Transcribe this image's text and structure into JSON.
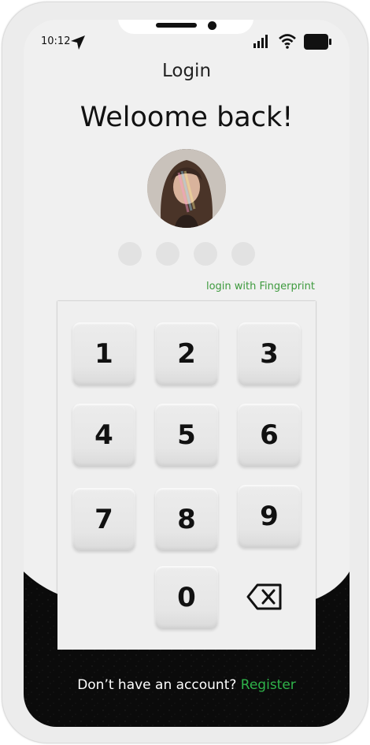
{
  "status_bar": {
    "time": "10:12",
    "icons": [
      "location-arrow-icon",
      "signal-icon",
      "wifi-icon",
      "battery-icon"
    ]
  },
  "header": {
    "title": "Login"
  },
  "welcome": {
    "text": "Weloome back!"
  },
  "pin": {
    "dot_count": 4,
    "entered": 0
  },
  "fingerprint": {
    "label": "login with Fingerprint",
    "color": "#3d9a3d"
  },
  "keypad": {
    "keys": [
      "1",
      "2",
      "3",
      "4",
      "5",
      "6",
      "7",
      "8",
      "9",
      "0"
    ],
    "backspace_icon": "backspace-icon"
  },
  "footer": {
    "prompt": "Don’t have an account?",
    "register_label": "Register",
    "register_color": "#2fb34a"
  },
  "colors": {
    "background": "#f0f0f0",
    "dark": "#0a0a0a",
    "accent": "#2fb34a"
  }
}
